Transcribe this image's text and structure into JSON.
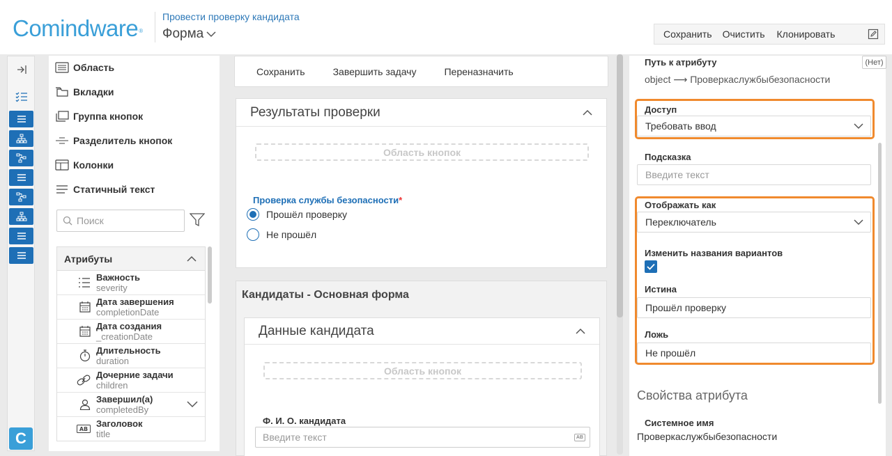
{
  "header": {
    "logo": "Comindware",
    "logo_mark": "®",
    "breadcrumb": "Провести проверку кандидата",
    "form_title": "Форма",
    "toolbar": {
      "save": "Сохранить",
      "clear": "Очистить",
      "clone": "Клонировать"
    }
  },
  "rail": {
    "logo_letter": "C"
  },
  "toolbox": {
    "tools": [
      "Область",
      "Вкладки",
      "Группа кнопок",
      "Разделитель кнопок",
      "Колонки",
      "Статичный текст"
    ],
    "search_placeholder": "Поиск",
    "attributes_title": "Атрибуты",
    "attributes": [
      {
        "name": "Важность",
        "sys": "severity",
        "icon": "list-icon"
      },
      {
        "name": "Дата завершения",
        "sys": "completionDate",
        "icon": "calendar-icon"
      },
      {
        "name": "Дата создания",
        "sys": "_creationDate",
        "icon": "calendar-icon"
      },
      {
        "name": "Длительность",
        "sys": "duration",
        "icon": "stopwatch-icon"
      },
      {
        "name": "Дочерние задачи",
        "sys": "children",
        "icon": "link-icon"
      },
      {
        "name": "Завершил(а)",
        "sys": "completedBy",
        "icon": "user-icon"
      },
      {
        "name": "Заголовок",
        "sys": "title",
        "icon": "text-ab-icon"
      }
    ]
  },
  "center": {
    "toolbar": {
      "save": "Сохранить",
      "complete": "Завершить задачу",
      "reassign": "Переназначить"
    },
    "card1": {
      "title": "Результаты проверки",
      "button_area": "Область кнопок",
      "question": "Проверка службы безопасности",
      "required_mark": "*",
      "options": [
        {
          "label": "Прошёл проверку",
          "selected": true
        },
        {
          "label": "Не прошёл",
          "selected": false
        }
      ]
    },
    "card2": {
      "title": "Кандидаты - Основная форма",
      "inner_title": "Данные кандидата",
      "button_area": "Область кнопок",
      "field_label": "Ф. И. О. кандидата",
      "field_placeholder": "Введите текст",
      "field_badge": "AB"
    }
  },
  "right": {
    "net_badge": "(Нет)",
    "path_label": "Путь к атрибуту",
    "path_value": "object ⟶ Проверкаслужбыбезопасности",
    "access_label": "Доступ",
    "access_value": "Требовать ввод",
    "hint_label": "Подсказка",
    "hint_placeholder": "Введите текст",
    "display_label": "Отображать как",
    "display_value": "Переключатель",
    "rename_label": "Изменить названия вариантов",
    "rename_checked": true,
    "true_label": "Истина",
    "true_value": "Прошёл проверку",
    "false_label": "Ложь",
    "false_value": "Не прошёл",
    "attr_props_title": "Свойства атрибута",
    "sysname_label": "Системное имя",
    "sysname_value": "Проверкаслужбыбезопасности"
  },
  "colors": {
    "accent": "#1e6fb6",
    "highlight": "#f08a2e",
    "logo": "#3a9fd8"
  }
}
